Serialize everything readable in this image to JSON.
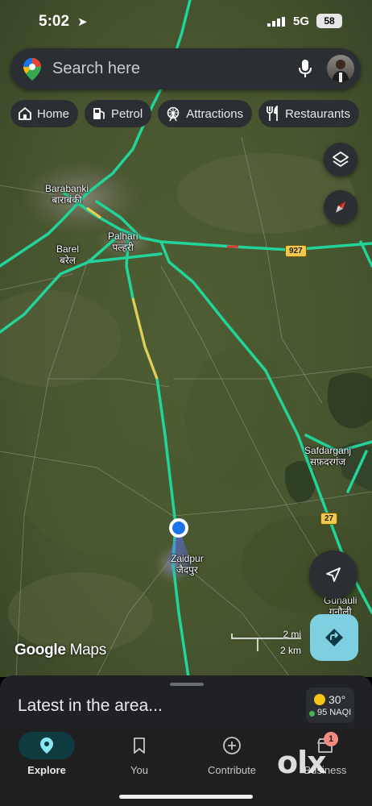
{
  "status_bar": {
    "time": "5:02",
    "network": "5G",
    "battery": "58"
  },
  "search": {
    "placeholder": "Search here"
  },
  "chips": [
    {
      "label": "Home",
      "icon": "home-icon"
    },
    {
      "label": "Petrol",
      "icon": "fuel-pump-icon"
    },
    {
      "label": "Attractions",
      "icon": "ferris-wheel-icon"
    },
    {
      "label": "Restaurants",
      "icon": "fork-knife-icon"
    }
  ],
  "map": {
    "places": [
      {
        "name": "Barabanki",
        "local": "बाराबंकी"
      },
      {
        "name": "Palhari",
        "local": "पल्हरी"
      },
      {
        "name": "Barel",
        "local": "बरेल"
      },
      {
        "name": "Safdarganj",
        "local": "सफ़दरगंज"
      },
      {
        "name": "Zaidpur",
        "local": "जैदपुर"
      },
      {
        "name": "Gunauli",
        "local": "गुनौली"
      }
    ],
    "road_shields": [
      "927",
      "27"
    ],
    "scale": {
      "miles": "2 mi",
      "km": "2 km"
    },
    "brand": {
      "google": "Google",
      "maps": "Maps"
    },
    "colors": {
      "road": "#22d39a",
      "location": "#1a73e8",
      "slow": "#f2c94c",
      "jam": "#e53935"
    }
  },
  "sheet": {
    "title": "Latest in the area..."
  },
  "weather": {
    "temp": "30°",
    "aqi": "95 NAQI"
  },
  "nav": {
    "items": [
      {
        "label": "Explore",
        "icon": "location-pin-icon"
      },
      {
        "label": "You",
        "icon": "bookmark-icon"
      },
      {
        "label": "Contribute",
        "icon": "plus-circle-icon"
      },
      {
        "label": "Business",
        "icon": "store-icon"
      }
    ],
    "business_badge": "1"
  },
  "watermark": "olx"
}
